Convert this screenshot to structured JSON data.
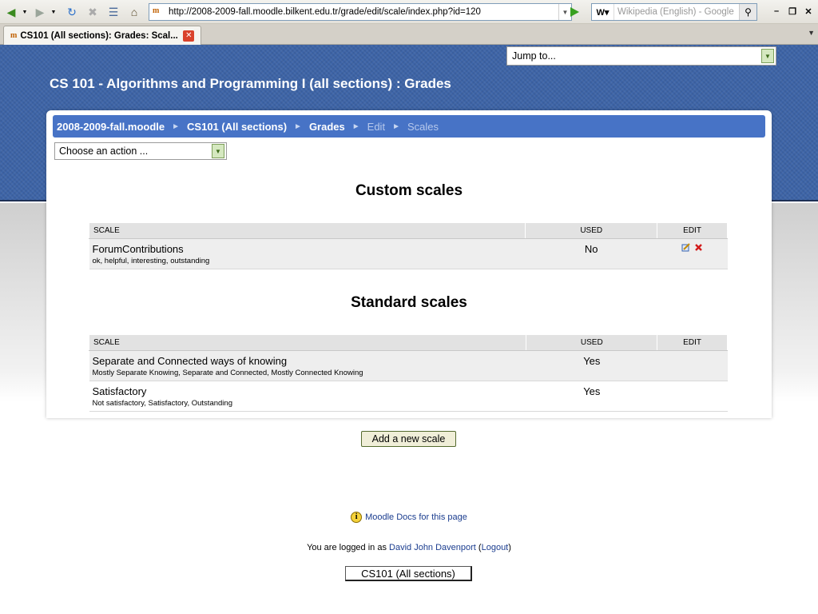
{
  "browser": {
    "url": "http://2008-2009-fall.moodle.bilkent.edu.tr/grade/edit/scale/index.php?id=120",
    "search_placeholder": "Wikipedia (English) - Google",
    "tab_title": "CS101 (All sections): Grades: Scal..."
  },
  "header": {
    "jump_to": "Jump to...",
    "course_title": "CS 101 - Algorithms and Programming I (all sections) : Grades"
  },
  "breadcrumb": [
    "2008-2009-fall.moodle",
    "CS101 (All sections)",
    "Grades",
    "Edit",
    "Scales"
  ],
  "action_select": "Choose an action ...",
  "custom_scales": {
    "heading": "Custom scales",
    "columns": [
      "Scale",
      "Used",
      "Edit"
    ],
    "rows": [
      {
        "name": "ForumContributions",
        "items": "ok, helpful, interesting, outstanding",
        "used": "No"
      }
    ]
  },
  "standard_scales": {
    "heading": "Standard scales",
    "columns": [
      "Scale",
      "Used",
      "Edit"
    ],
    "rows": [
      {
        "name": "Separate and Connected ways of knowing",
        "items": "Mostly Separate Knowing, Separate and Connected, Mostly Connected Knowing",
        "used": "Yes"
      },
      {
        "name": "Satisfactory",
        "items": "Not satisfactory, Satisfactory, Outstanding",
        "used": "Yes"
      }
    ]
  },
  "add_button": "Add a new scale",
  "footer": {
    "docs_link": "Moodle Docs for this page",
    "logged_prefix": "You are logged in as ",
    "user": "David John Davenport",
    "open_paren": " (",
    "logout": "Logout",
    "close_paren": ")",
    "course_button": "CS101 (All sections)"
  },
  "colors": {
    "header_blue": "#3d64a7",
    "navbar_blue": "#4773c6",
    "link": "#1b3d8f"
  }
}
